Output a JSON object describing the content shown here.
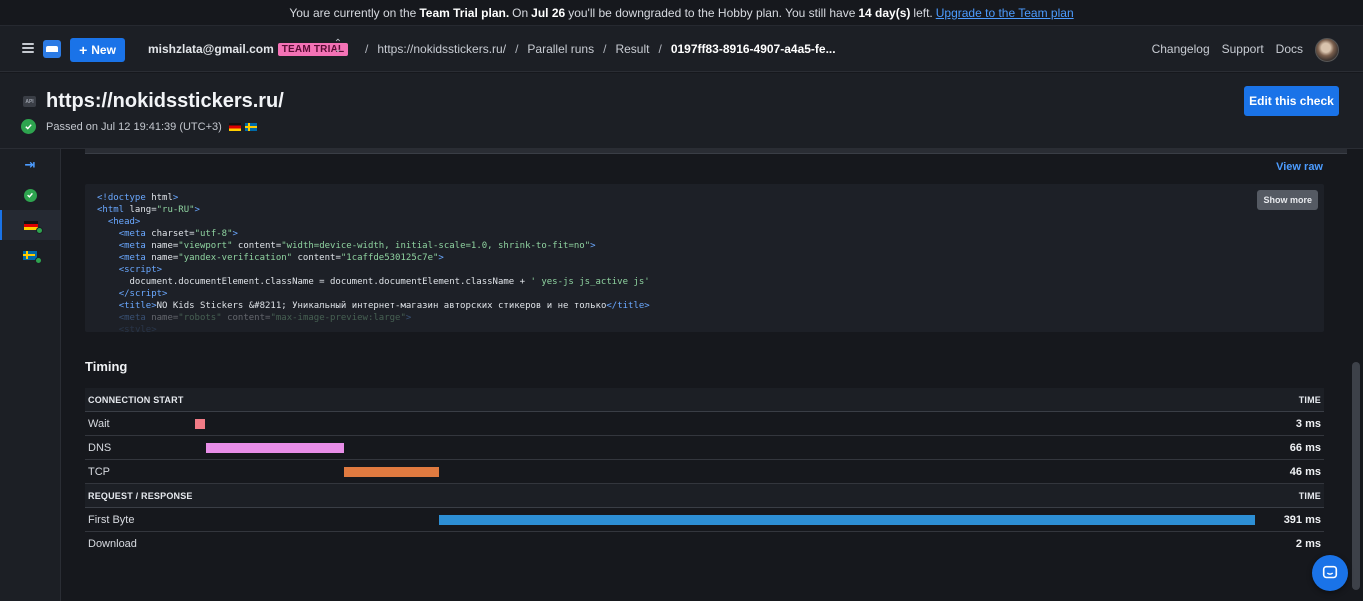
{
  "banner": {
    "t1": "You are currently on the",
    "plan": "Team Trial plan.",
    "t2": "On",
    "date": "Jul 26",
    "t3": "you'll be downgraded to the Hobby plan. You still have",
    "days": "14 day(s)",
    "t4": "left.",
    "link": "Upgrade to the Team plan"
  },
  "nav": {
    "new_label": "New",
    "account_email": "mishzlata@gmail.com",
    "account_badge": "TEAM TRIAL",
    "breadcrumbs": [
      "https://nokidsstickers.ru/",
      "Parallel runs",
      "Result"
    ],
    "current": "0197ff83-8916-4907-a4a5-fe...",
    "links": [
      "Changelog",
      "Support",
      "Docs"
    ]
  },
  "header": {
    "icon_label": "API",
    "title": "https://nokidsstickers.ru/",
    "status": "Passed on Jul 12 19:41:39 (UTC+3)",
    "edit_label": "Edit this check"
  },
  "response": {
    "view_raw": "View raw",
    "show_more": "Show more"
  },
  "timing": {
    "title": "Timing",
    "connection_header": "CONNECTION START",
    "request_header": "REQUEST / RESPONSE",
    "time_header": "TIME",
    "connection_rows": [
      {
        "label": "Wait",
        "value": "3 ms",
        "color": "#f17b86"
      },
      {
        "label": "DNS",
        "value": "66 ms",
        "color": "#e88ee8"
      },
      {
        "label": "TCP",
        "value": "46 ms",
        "color": "#e07a40"
      }
    ],
    "request_rows": [
      {
        "label": "First Byte",
        "value": "391 ms",
        "color": "#2d8fd5"
      },
      {
        "label": "Download",
        "value": "2 ms",
        "color": "#4caf50"
      }
    ]
  },
  "icons": {
    "menu": "hamburger-icon",
    "logo": "checkly-logo-icon",
    "plus": "plus-icon",
    "chevrons": "chevron-up-down-icon",
    "passed": "check-circle-icon",
    "collapse": "expand-sidebar-icon",
    "chat": "chat-icon"
  }
}
